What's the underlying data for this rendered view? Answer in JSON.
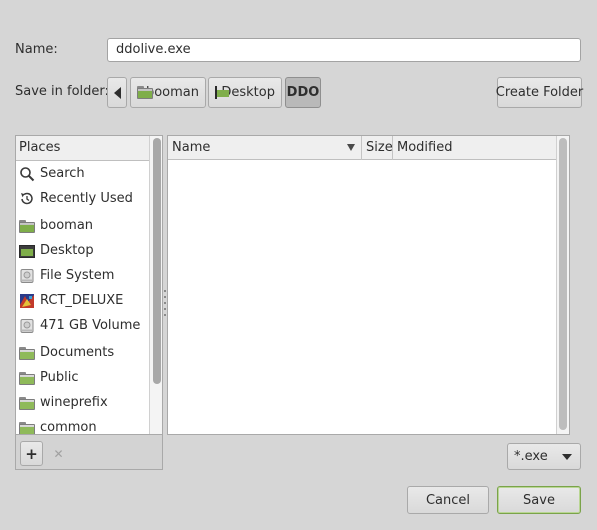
{
  "name_row": {
    "label": "Name:",
    "value": "ddolive.exe"
  },
  "folder_row": {
    "label": "Save in folder:",
    "crumbs": [
      {
        "label": "booman",
        "icon": "home-folder-icon"
      },
      {
        "label": "Desktop",
        "icon": "desktop-icon"
      },
      {
        "label": "DDO"
      }
    ],
    "create_folder_label": "Create Folder"
  },
  "places": {
    "header": "Places",
    "items": [
      {
        "label": "Search",
        "icon": "search-icon"
      },
      {
        "label": "Recently Used",
        "icon": "recent-icon"
      },
      {
        "label": "booman",
        "icon": "home-folder-icon"
      },
      {
        "label": "Desktop",
        "icon": "desktop-icon"
      },
      {
        "label": "File System",
        "icon": "drive-icon"
      },
      {
        "label": "RCT_DELUXE",
        "icon": "cd-icon"
      },
      {
        "label": "471 GB Volume",
        "icon": "drive-icon"
      },
      {
        "label": "Documents",
        "icon": "folder-icon"
      },
      {
        "label": "Public",
        "icon": "folder-icon"
      },
      {
        "label": "wineprefix",
        "icon": "folder-icon"
      },
      {
        "label": "common",
        "icon": "folder-icon"
      }
    ],
    "add_label": "+",
    "remove_label": "✕"
  },
  "files": {
    "columns": {
      "name": "Name",
      "size": "Size",
      "modified": "Modified"
    },
    "rows": []
  },
  "filter": {
    "value": "*.exe"
  },
  "actions": {
    "cancel": "Cancel",
    "save": "Save"
  },
  "colors": {
    "accent_green": "#7fae4a",
    "dialog_bg": "#d6d6d6"
  }
}
